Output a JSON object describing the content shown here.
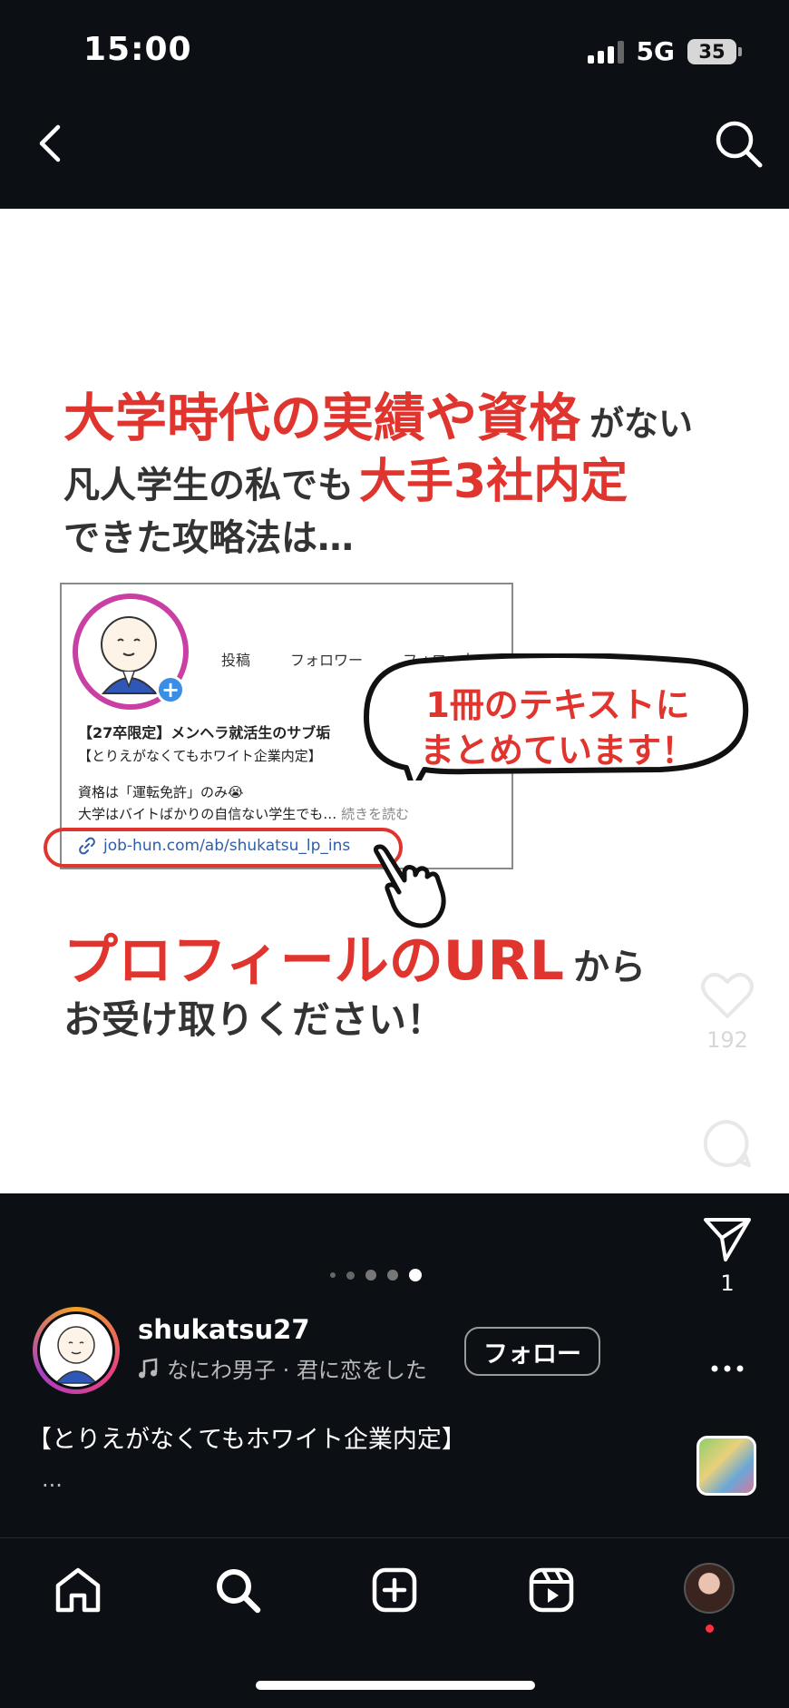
{
  "status_bar": {
    "time": "15:00",
    "network": "5G",
    "battery": "35"
  },
  "post_image": {
    "line1_highlight": "大学時代の実績や資格",
    "line1_rest": "がない",
    "line2_lead": "凡人学生の私でも",
    "line2_highlight": "大手3社内定",
    "line3": "できた攻略法は…",
    "profile": {
      "stats": [
        "投稿",
        "フォロワー",
        "フォロー中"
      ],
      "name": "【27卒限定】メンヘラ就活生のサブ垢",
      "bio_line1": "【とりえがなくてもホワイト企業内定】",
      "bio_line2": "資格は「運転免許」のみ😭",
      "bio_line3": "大学はバイトばかりの自信ない学生でも…",
      "read_more": "続きを読む",
      "link": "job-hun.com/ab/shukatsu_lp_ins"
    },
    "bubble_line1": "1冊のテキストに",
    "bubble_line2": "まとめています！",
    "line4_highlight": "プロフィールのURL",
    "line4_rest": "から",
    "line5": "お受け取りください！"
  },
  "actions": {
    "likes": "192",
    "shares": "1"
  },
  "carousel": {
    "total": 5,
    "active": 5
  },
  "post": {
    "username": "shukatsu27",
    "music": "なにわ男子 · 君に恋をした",
    "follow_label": "フォロー",
    "caption": "【とりえがなくてもホワイト企業内定】",
    "caption_more": "..."
  },
  "icons": {
    "back": "chevron-left-icon",
    "search": "search-icon",
    "like": "heart-icon",
    "comment": "comment-icon",
    "share": "send-icon",
    "more": "more-icon",
    "music": "music-note-icon",
    "nav_home": "home-icon",
    "nav_search": "search-icon",
    "nav_create": "plus-square-icon",
    "nav_reels": "reels-icon"
  },
  "colors": {
    "accent_red": "#e0342e",
    "notification": "#ff3040",
    "link_blue": "#2f5da8"
  }
}
